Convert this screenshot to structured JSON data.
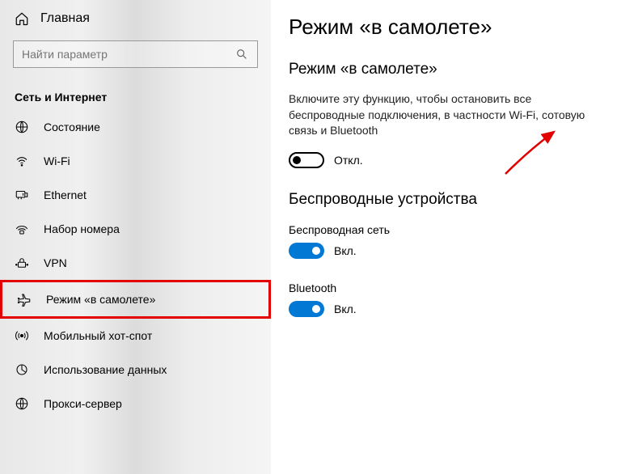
{
  "sidebar": {
    "home_label": "Главная",
    "search_placeholder": "Найти параметр",
    "section_header": "Сеть и Интернет",
    "items": [
      {
        "label": "Состояние"
      },
      {
        "label": "Wi-Fi"
      },
      {
        "label": "Ethernet"
      },
      {
        "label": "Набор номера"
      },
      {
        "label": "VPN"
      },
      {
        "label": "Режим «в самолете»"
      },
      {
        "label": "Мобильный хот-спот"
      },
      {
        "label": "Использование данных"
      },
      {
        "label": "Прокси-сервер"
      }
    ]
  },
  "main": {
    "title": "Режим «в самолете»",
    "subtitle": "Режим «в самолете»",
    "description": "Включите эту функцию, чтобы остановить все беспроводные подключения, в частности Wi-Fi, сотовую связь и Bluetooth",
    "airplane_toggle_label": "Откл.",
    "wireless_header": "Беспроводные устройства",
    "wifi_label": "Беспроводная сеть",
    "wifi_toggle_label": "Вкл.",
    "bt_label": "Bluetooth",
    "bt_toggle_label": "Вкл."
  }
}
